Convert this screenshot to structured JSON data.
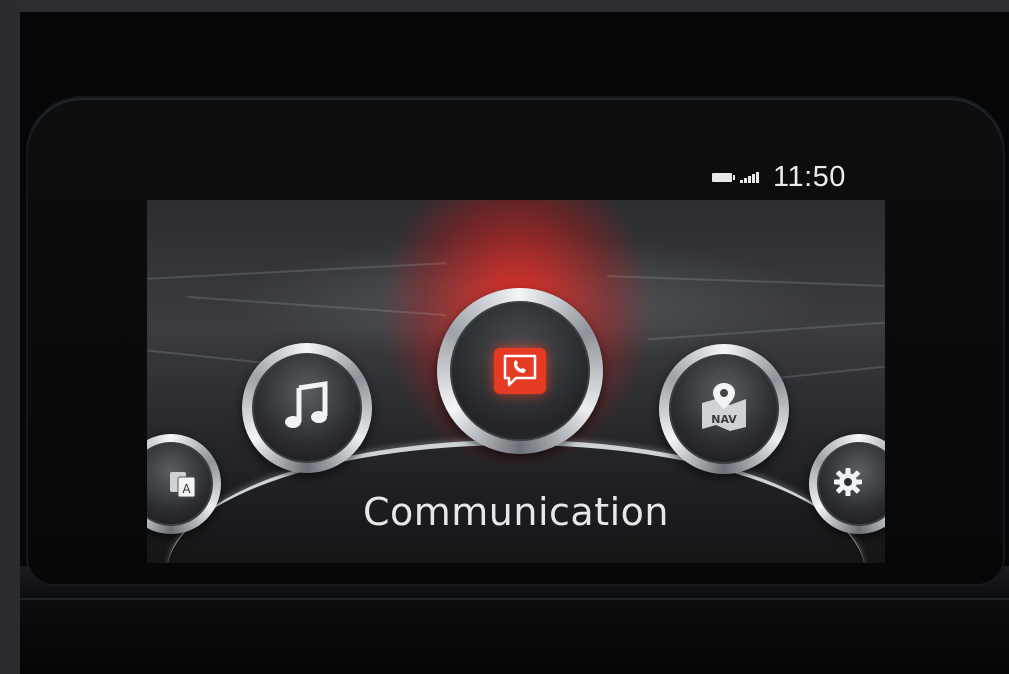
{
  "status_bar": {
    "time": "11:50",
    "battery_icon": "battery-icon",
    "signal_icon": "signal-strength-icon"
  },
  "menu": {
    "selected_label": "Communication",
    "items": [
      {
        "id": "applications",
        "icon": "applications-icon",
        "badge": "A"
      },
      {
        "id": "entertainment",
        "icon": "music-note-icon"
      },
      {
        "id": "communication",
        "icon": "phone-message-icon",
        "selected": true
      },
      {
        "id": "navigation",
        "icon": "nav-map-icon",
        "badge": "NAV"
      },
      {
        "id": "settings",
        "icon": "gear-icon"
      }
    ]
  },
  "colors": {
    "accent_red": "#e43b22",
    "text": "#e6e7e9"
  }
}
